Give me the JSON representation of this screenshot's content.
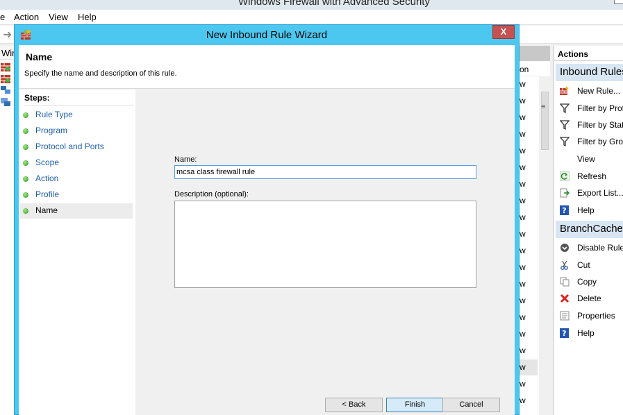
{
  "mmc": {
    "title": "Windows Firewall with Advanced Security",
    "menu": [
      "e",
      "Action",
      "View",
      "Help"
    ],
    "tree_header": "Wir",
    "list": {
      "column_header": "on",
      "cell_value": "w",
      "rows": 20
    },
    "actions": {
      "header": "Actions",
      "sections": [
        {
          "title": "Inbound Rules",
          "items": [
            {
              "label": "New Rule...",
              "icon": "new-rule-icon"
            },
            {
              "label": "Filter by Profile",
              "icon": "filter-icon"
            },
            {
              "label": "Filter by State",
              "icon": "filter-icon"
            },
            {
              "label": "Filter by Group",
              "icon": "filter-icon"
            },
            {
              "label": "View",
              "icon": ""
            },
            {
              "label": "Refresh",
              "icon": "refresh-icon"
            },
            {
              "label": "Export List...",
              "icon": "export-icon"
            },
            {
              "label": "Help",
              "icon": "help-icon"
            }
          ]
        },
        {
          "title": "BranchCache Content Retrieval",
          "items": [
            {
              "label": "Disable Rule",
              "icon": "disable-icon"
            },
            {
              "label": "Cut",
              "icon": "cut-icon"
            },
            {
              "label": "Copy",
              "icon": "copy-icon"
            },
            {
              "label": "Delete",
              "icon": "delete-icon"
            },
            {
              "label": "Properties",
              "icon": "properties-icon"
            },
            {
              "label": "Help",
              "icon": "help-icon"
            }
          ]
        }
      ]
    }
  },
  "wizard": {
    "title": "New Inbound Rule Wizard",
    "close_label": "X",
    "header": {
      "title": "Name",
      "subtitle": "Specify the name and description of this rule."
    },
    "steps_heading": "Steps:",
    "steps": [
      {
        "label": "Rule Type",
        "current": false
      },
      {
        "label": "Program",
        "current": false
      },
      {
        "label": "Protocol and Ports",
        "current": false
      },
      {
        "label": "Scope",
        "current": false
      },
      {
        "label": "Action",
        "current": false
      },
      {
        "label": "Profile",
        "current": false
      },
      {
        "label": "Name",
        "current": true
      }
    ],
    "form": {
      "name_label": "Name:",
      "name_value": "mcsa class firewall rule",
      "description_label": "Description (optional):",
      "description_value": ""
    },
    "buttons": {
      "back": "< Back",
      "finish": "Finish",
      "cancel": "Cancel"
    }
  },
  "colors": {
    "wizard_frame": "#4cc8f0",
    "close_button": "#c75050",
    "actions_section": "#d8e6f3",
    "step_dot": "#2e9d1c",
    "step_link": "#1f5fb0"
  }
}
